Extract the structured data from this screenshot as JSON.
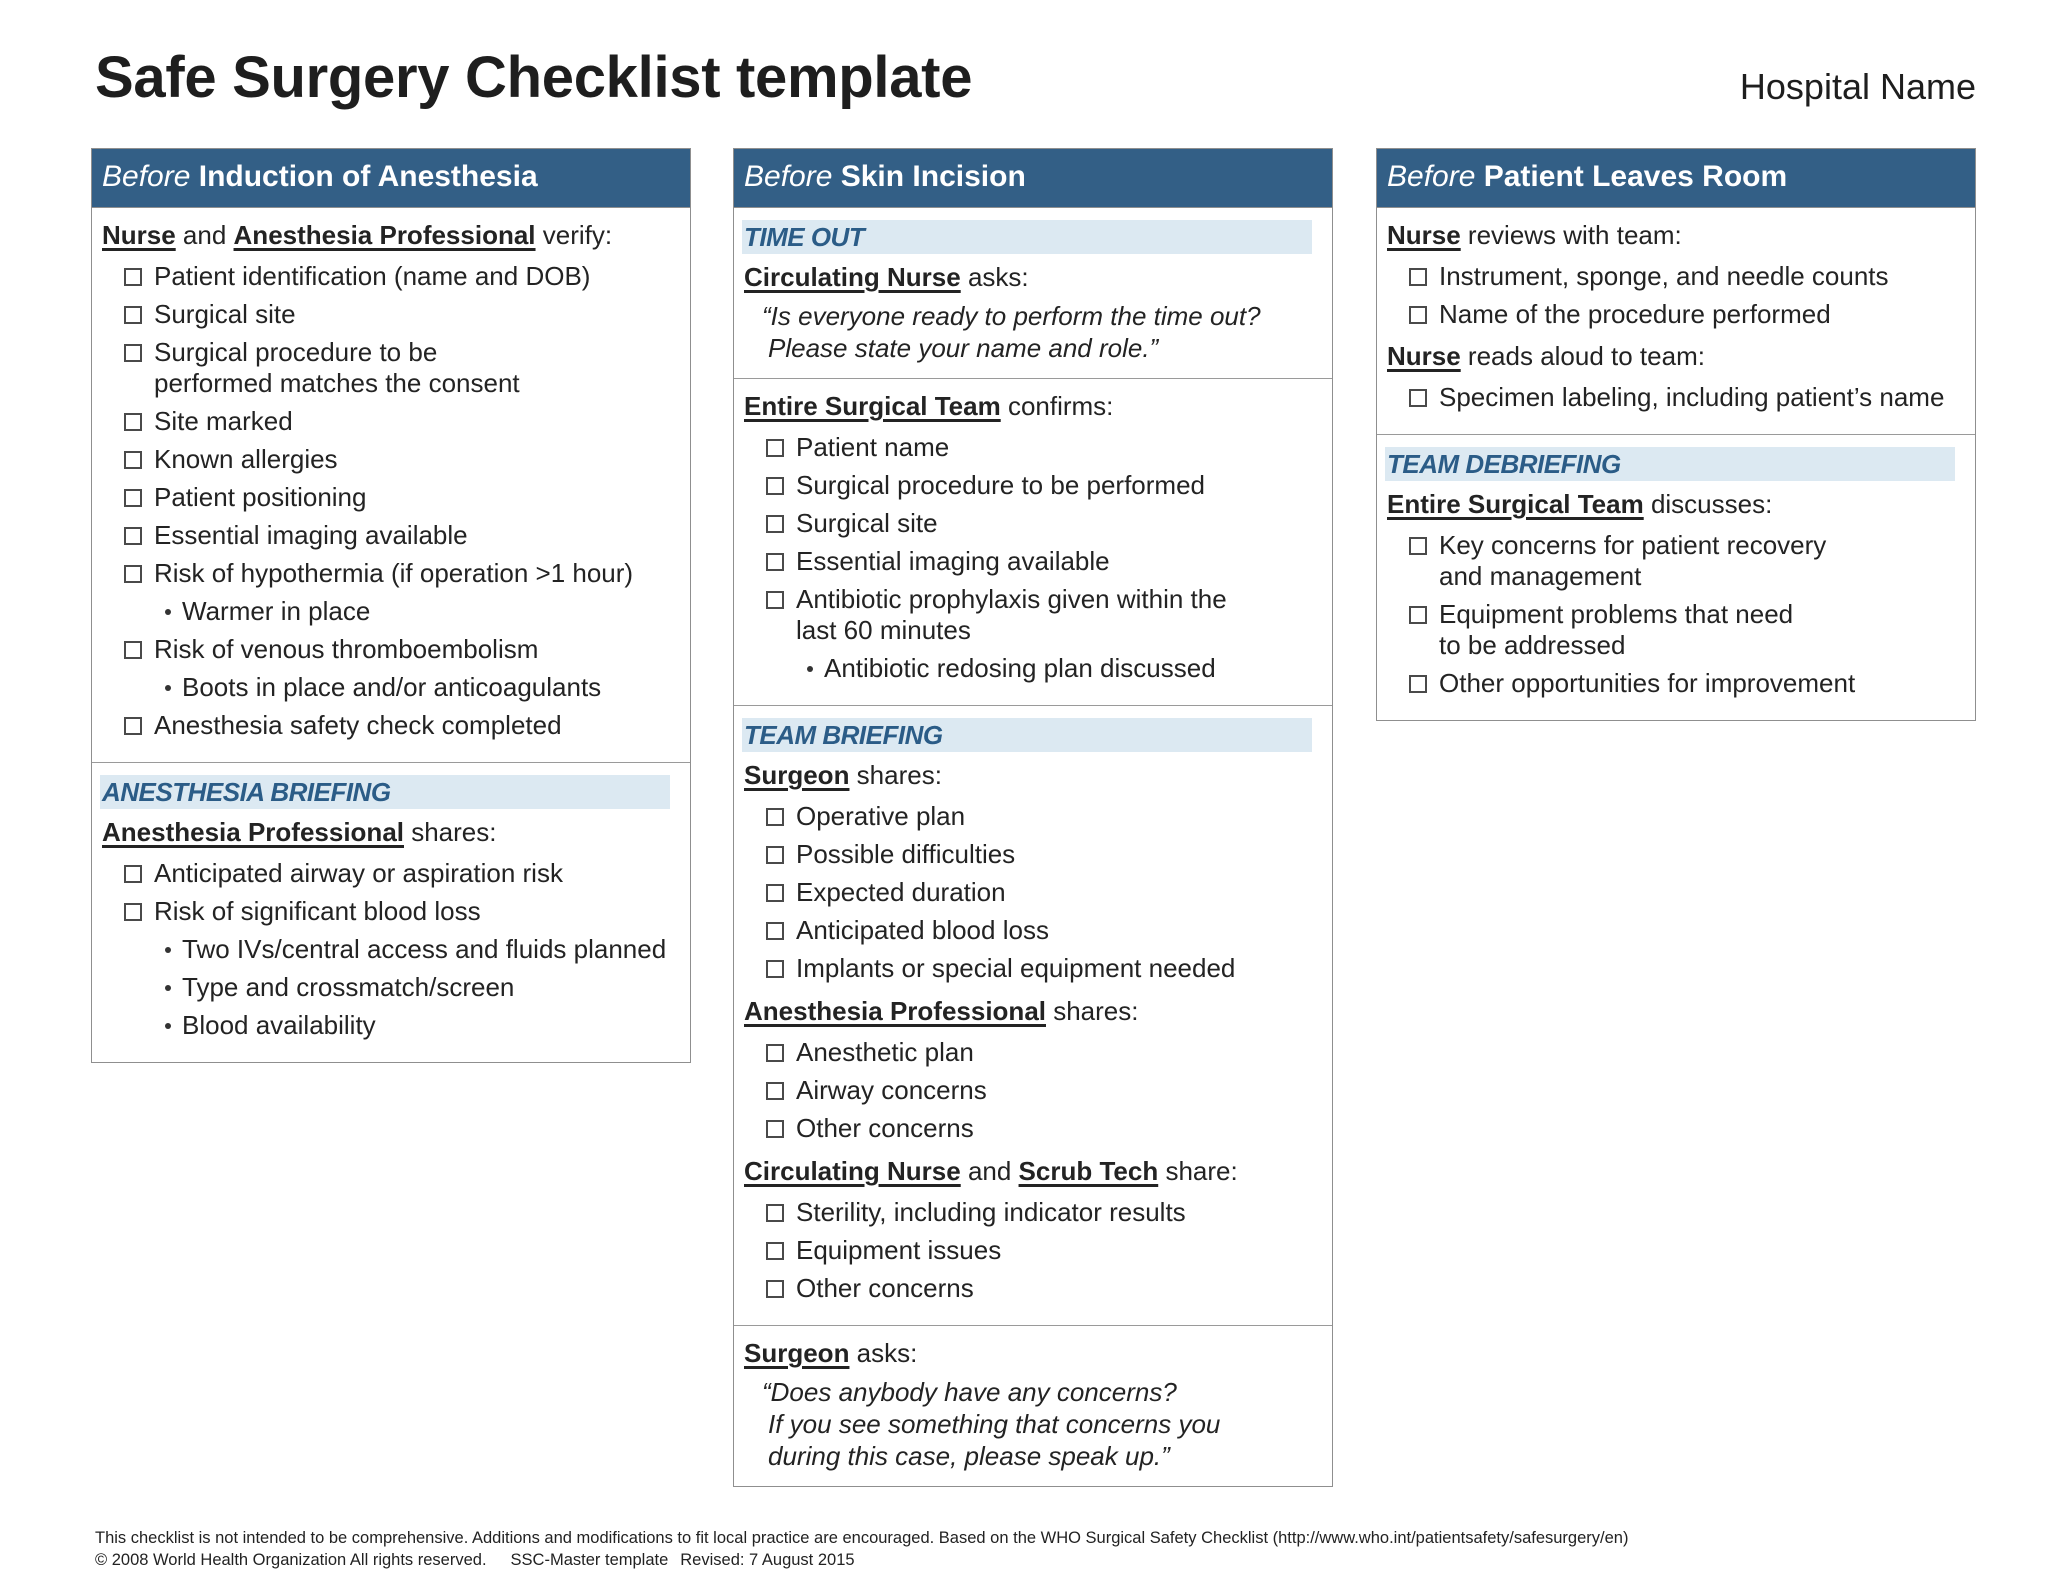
{
  "header": {
    "title": "Safe Surgery Checklist template",
    "hospital_name": "Hospital Name"
  },
  "colors": {
    "header_band": "#335f86",
    "section_band_bg": "#dce9f2",
    "section_band_text": "#2b5c87"
  },
  "col1": {
    "before": "Before",
    "title": "Induction of Anesthesia",
    "s1": {
      "role1": "Nurse",
      "mid": " and ",
      "role2": "Anesthesia Professional",
      "verb": " verify:",
      "items": [
        "Patient identification (name and DOB)",
        "Surgical site",
        "Surgical procedure to be performed matches the consent",
        "Site marked",
        "Known allergies",
        "Patient positioning",
        "Essential imaging available",
        "Risk of hypothermia (if operation >1 hour)",
        "Warmer in place",
        "Risk of venous thromboembolism",
        "Boots in place and/or anticoagulants",
        "Anesthesia safety check completed"
      ]
    },
    "s2": {
      "band": "ANESTHESIA BRIEFING",
      "role": "Anesthesia Professional",
      "verb": " shares:",
      "items": [
        "Anticipated airway or aspiration risk",
        "Risk of significant blood loss",
        "Two IVs/central access and fluids planned",
        "Type and crossmatch/screen",
        "Blood availability"
      ]
    }
  },
  "col2": {
    "before": "Before",
    "title": "Skin Incision",
    "s1": {
      "band": "TIME OUT",
      "role": "Circulating Nurse",
      "verb": " asks:",
      "quote": [
        "“Is everyone ready to perform the time out?",
        "Please state your name and role.”"
      ]
    },
    "s2": {
      "role": "Entire Surgical Team",
      "verb": " confirms:",
      "items": [
        "Patient name",
        "Surgical procedure to be performed",
        "Surgical site",
        "Essential imaging available",
        "Antibiotic prophylaxis given within the last 60 minutes",
        "Antibiotic redosing plan discussed"
      ]
    },
    "s3": {
      "band": "TEAM BRIEFING",
      "surgeon": {
        "role": "Surgeon",
        "verb": " shares:",
        "items": [
          "Operative plan",
          "Possible difficulties",
          "Expected duration",
          "Anticipated blood loss",
          "Implants or special equipment needed"
        ]
      },
      "anesthesia": {
        "role": "Anesthesia Professional",
        "verb": " shares:",
        "items": [
          "Anesthetic plan",
          "Airway concerns",
          "Other concerns"
        ]
      },
      "nursing": {
        "role1": "Circulating Nurse",
        "mid": " and ",
        "role2": "Scrub Tech",
        "verb": " share:",
        "items": [
          "Sterility, including indicator results",
          "Equipment issues",
          "Other concerns"
        ]
      }
    },
    "s4": {
      "role": "Surgeon",
      "verb": " asks:",
      "quote": [
        "“Does anybody have any concerns?",
        "If you see something that concerns you",
        "during this case, please speak up.”"
      ]
    }
  },
  "col3": {
    "before": "Before",
    "title": "Patient Leaves Room",
    "s1": {
      "review": {
        "role": "Nurse",
        "verb": " reviews with team:",
        "items": [
          "Instrument, sponge, and needle counts",
          "Name of the procedure performed"
        ]
      },
      "aloud": {
        "role": "Nurse",
        "verb": " reads aloud to team:",
        "items": [
          "Specimen labeling, including patient’s name"
        ]
      }
    },
    "s2": {
      "band": "TEAM DEBRIEFING",
      "role": "Entire Surgical Team",
      "verb": " discusses:",
      "items": [
        "Key concerns for patient recovery and management",
        "Equipment problems that need to be addressed",
        "Other opportunities for improvement"
      ]
    }
  },
  "footer": {
    "line1": "This checklist is not intended to be comprehensive. Additions and modifications to fit local practice are encouraged. Based on the WHO Surgical Safety Checklist (http://www.who.int/patientsafety/safesurgery/en)",
    "copyright": "© 2008 World Health Organization All rights reserved.",
    "template": "SSC-Master template",
    "revised": "Revised: 7 August 2015"
  }
}
